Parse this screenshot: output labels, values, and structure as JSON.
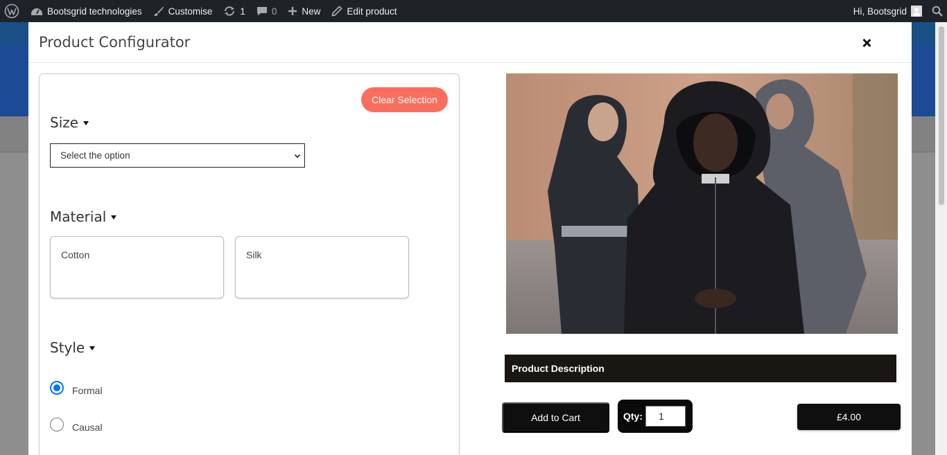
{
  "adminbar": {
    "site_name": "Bootsgrid technologies",
    "customise": "Customise",
    "updates_count": "1",
    "comments_count": "0",
    "new_label": "New",
    "edit_label": "Edit product",
    "greeting": "Hi, Bootsgrid"
  },
  "modal": {
    "title": "Product Configurator"
  },
  "config": {
    "clear_label": "Clear Selection",
    "size": {
      "title": "Size",
      "select_value": "Select the option"
    },
    "material": {
      "title": "Material",
      "options": [
        "Cotton",
        "Silk"
      ]
    },
    "style": {
      "title": "Style",
      "options": [
        {
          "label": "Formal",
          "checked": true
        },
        {
          "label": "Causal",
          "checked": false
        }
      ]
    }
  },
  "product": {
    "description_label": "Product Description",
    "add_to_cart": "Add to Cart",
    "qty_label": "Qty:",
    "qty_value": "1",
    "price": "£4.00"
  },
  "colors": {
    "accent_button": "#fb6e5e",
    "radio_checked": "#0075ff",
    "adminbar_bg": "#1d2327"
  }
}
